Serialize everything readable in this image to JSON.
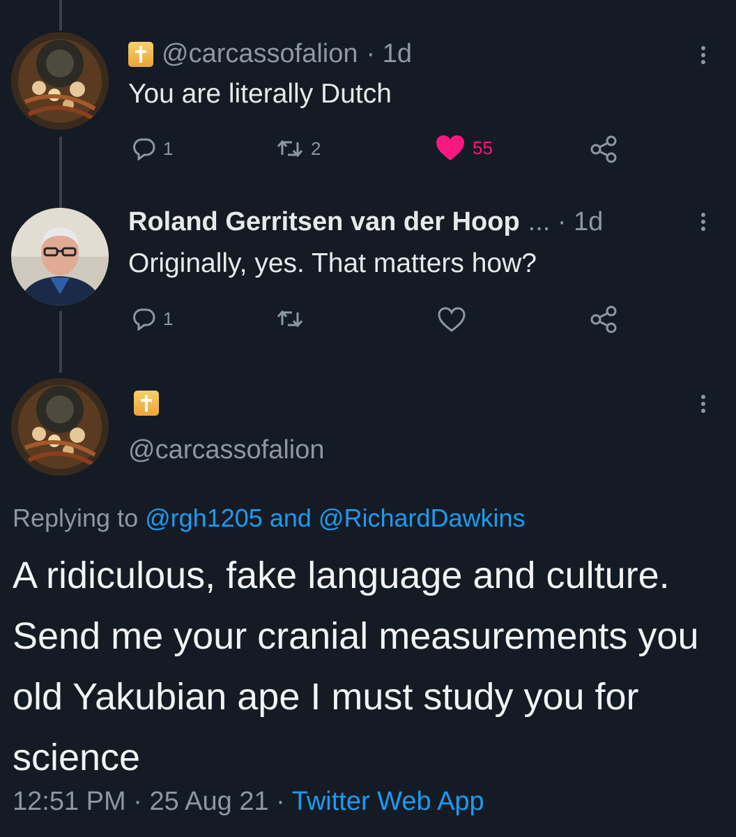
{
  "tweet1": {
    "handle": "@carcassofalion",
    "time": "1d",
    "text": "You are literally Dutch",
    "reply_count": "1",
    "retweet_count": "2",
    "like_count": "55"
  },
  "tweet2": {
    "name": "Roland Gerritsen van der Hoop",
    "ellipsis": "...",
    "time": "1d",
    "text": "Originally, yes. That matters how?",
    "reply_count": "1"
  },
  "main_tweet": {
    "handle": "@carcassofalion",
    "replying_prefix": "Replying to",
    "mention1": "@rgh1205",
    "and": "and",
    "mention2": "@RichardDawkins",
    "text": "A ridiculous, fake language and culture. Send me your cranial measurements you old Yakubian ape I must study you for science",
    "time": "12:51 PM",
    "date": "25 Aug 21",
    "app": "Twitter Web App"
  },
  "separator": "·",
  "colors": {
    "background": "#151b24",
    "text": "#e7e9ea",
    "muted": "#8b98a5",
    "link": "#1d9bf0",
    "like": "#f91880"
  },
  "icons": [
    "reply-icon",
    "retweet-icon",
    "heart-icon",
    "share-icon",
    "more-icon",
    "flair-icon"
  ]
}
